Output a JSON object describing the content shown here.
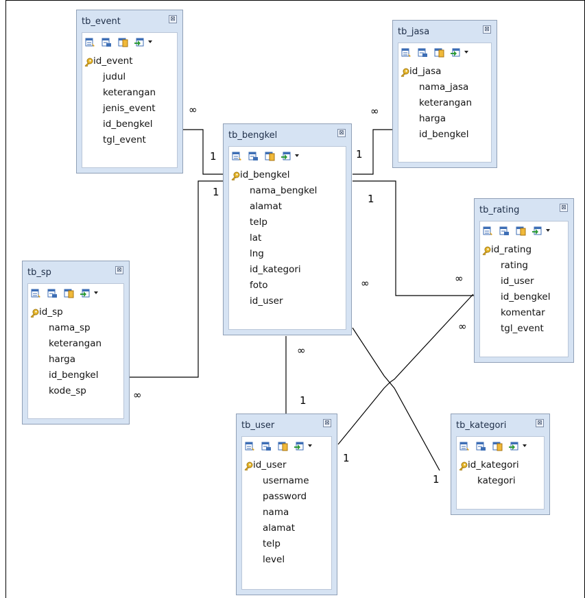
{
  "tables": [
    {
      "name": "tb_event",
      "fields": [
        "id_event",
        "judul",
        "keterangan",
        "jenis_event",
        "id_bengkel",
        "tgl_event"
      ]
    },
    {
      "name": "tb_jasa",
      "fields": [
        "id_jasa",
        "nama_jasa",
        "keterangan",
        "harga",
        "id_bengkel"
      ]
    },
    {
      "name": "tb_bengkel",
      "fields": [
        "id_bengkel",
        "nama_bengkel",
        "alamat",
        "telp",
        "lat",
        "lng",
        "id_kategori",
        "foto",
        "id_user"
      ]
    },
    {
      "name": "tb_rating",
      "fields": [
        "id_rating",
        "rating",
        "id_user",
        "id_bengkel",
        "komentar",
        "tgl_event"
      ]
    },
    {
      "name": "tb_sp",
      "fields": [
        "id_sp",
        "nama_sp",
        "keterangan",
        "harga",
        "id_bengkel",
        "kode_sp"
      ]
    },
    {
      "name": "tb_user",
      "fields": [
        "id_user",
        "username",
        "password",
        "nama",
        "alamat",
        "telp",
        "level"
      ]
    },
    {
      "name": "tb_kategori",
      "fields": [
        "id_kategori",
        "kategori"
      ]
    }
  ],
  "close_glyph": "⊠",
  "cardinality": {
    "one": "1",
    "many": "∞"
  },
  "colors": {
    "window_frame": "#d6e3f3",
    "window_border": "#8f9fb6",
    "line": "#000000"
  },
  "icons": [
    "add-field-icon",
    "edit-field-icon",
    "index-icon",
    "export-icon",
    "primary-key-icon",
    "close-icon"
  ]
}
